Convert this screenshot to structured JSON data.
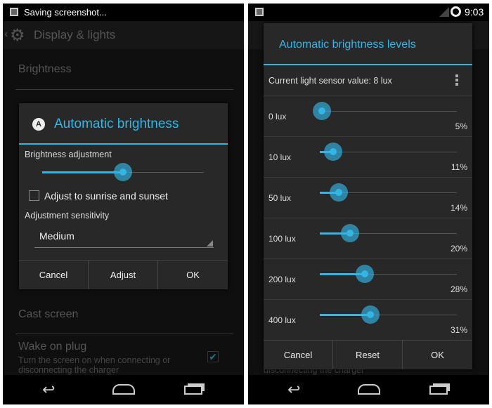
{
  "left": {
    "status_text": "Saving screenshot...",
    "action_title": "Display & lights",
    "items": {
      "brightness": "Brightness",
      "cast": "Cast screen",
      "wake_title": "Wake on plug",
      "wake_sub1": "Turn the screen on when connecting or",
      "wake_sub2": "disconnecting the charger",
      "wake_checked": true
    },
    "dialog": {
      "title": "Automatic brightness",
      "adjust_label": "Brightness adjustment",
      "adjust_value": 0.5,
      "checkbox_label": "Adjust to sunrise and sunset",
      "checkbox_checked": false,
      "sensitivity_label": "Adjustment sensitivity",
      "sensitivity_value": "Medium",
      "buttons": [
        "Cancel",
        "Adjust",
        "OK"
      ]
    }
  },
  "right": {
    "time": "9:03",
    "dialog": {
      "title": "Automatic brightness levels",
      "sensor_text": "Current light sensor value: 8 lux",
      "levels": [
        {
          "label": "0 lux",
          "percent": "5%",
          "value": 5
        },
        {
          "label": "10 lux",
          "percent": "11%",
          "value": 11
        },
        {
          "label": "50 lux",
          "percent": "14%",
          "value": 14
        },
        {
          "label": "100 lux",
          "percent": "20%",
          "value": 20
        },
        {
          "label": "200 lux",
          "percent": "28%",
          "value": 28
        },
        {
          "label": "400 lux",
          "percent": "31%",
          "value": 31
        }
      ],
      "buttons": [
        "Cancel",
        "Reset",
        "OK"
      ]
    },
    "bg_text": "disconnecting the charger"
  },
  "colors": {
    "accent": "#33b5e5"
  }
}
